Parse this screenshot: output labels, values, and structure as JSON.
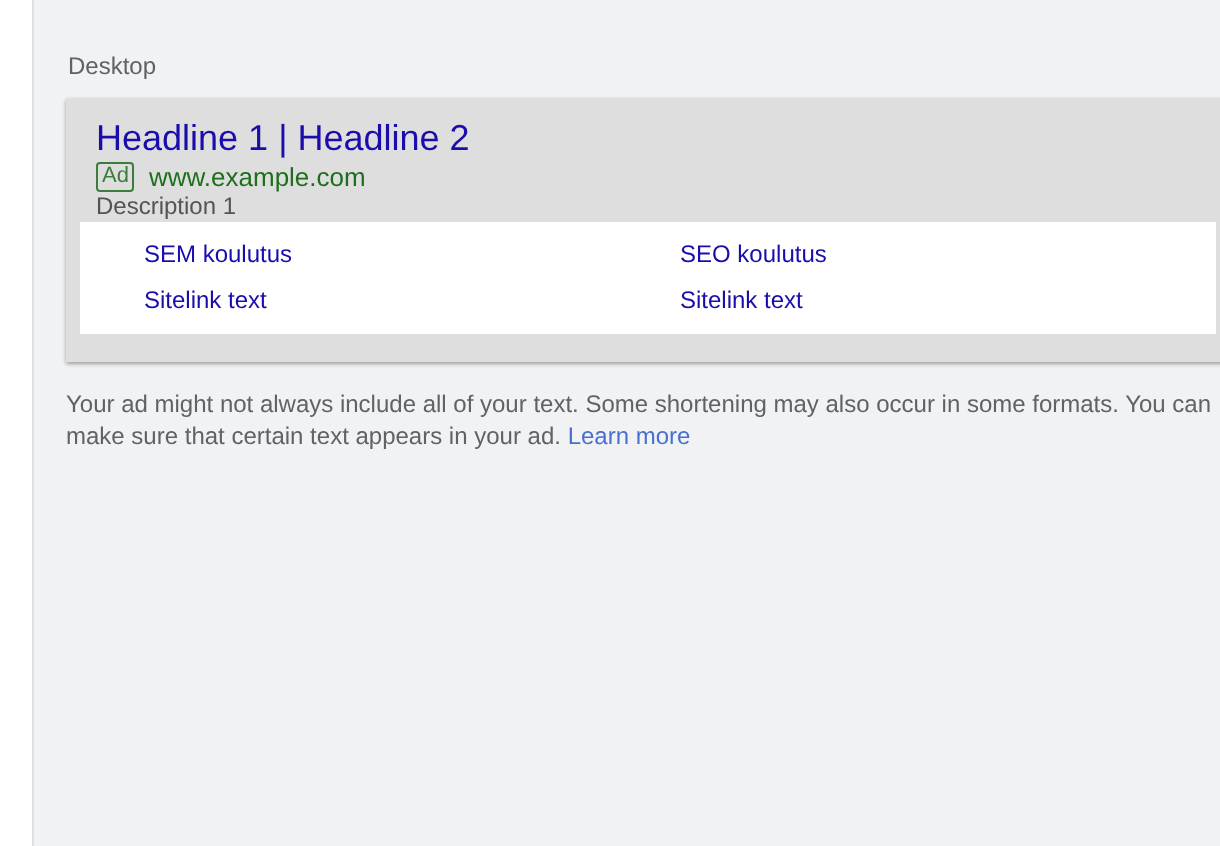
{
  "section_label": "Desktop",
  "ad": {
    "headline": "Headline 1 | Headline 2",
    "badge": "Ad",
    "url": "www.example.com",
    "description": "Description 1",
    "sitelinks": [
      {
        "text": "SEM koulutus"
      },
      {
        "text": "SEO koulutus"
      },
      {
        "text": "Sitelink text"
      },
      {
        "text": "Sitelink text"
      }
    ]
  },
  "note": {
    "text": "Your ad might not always include all of your text. Some shortening may also occur in some formats. You can make sure that certain text appears in your ad.",
    "link": "Learn more"
  }
}
